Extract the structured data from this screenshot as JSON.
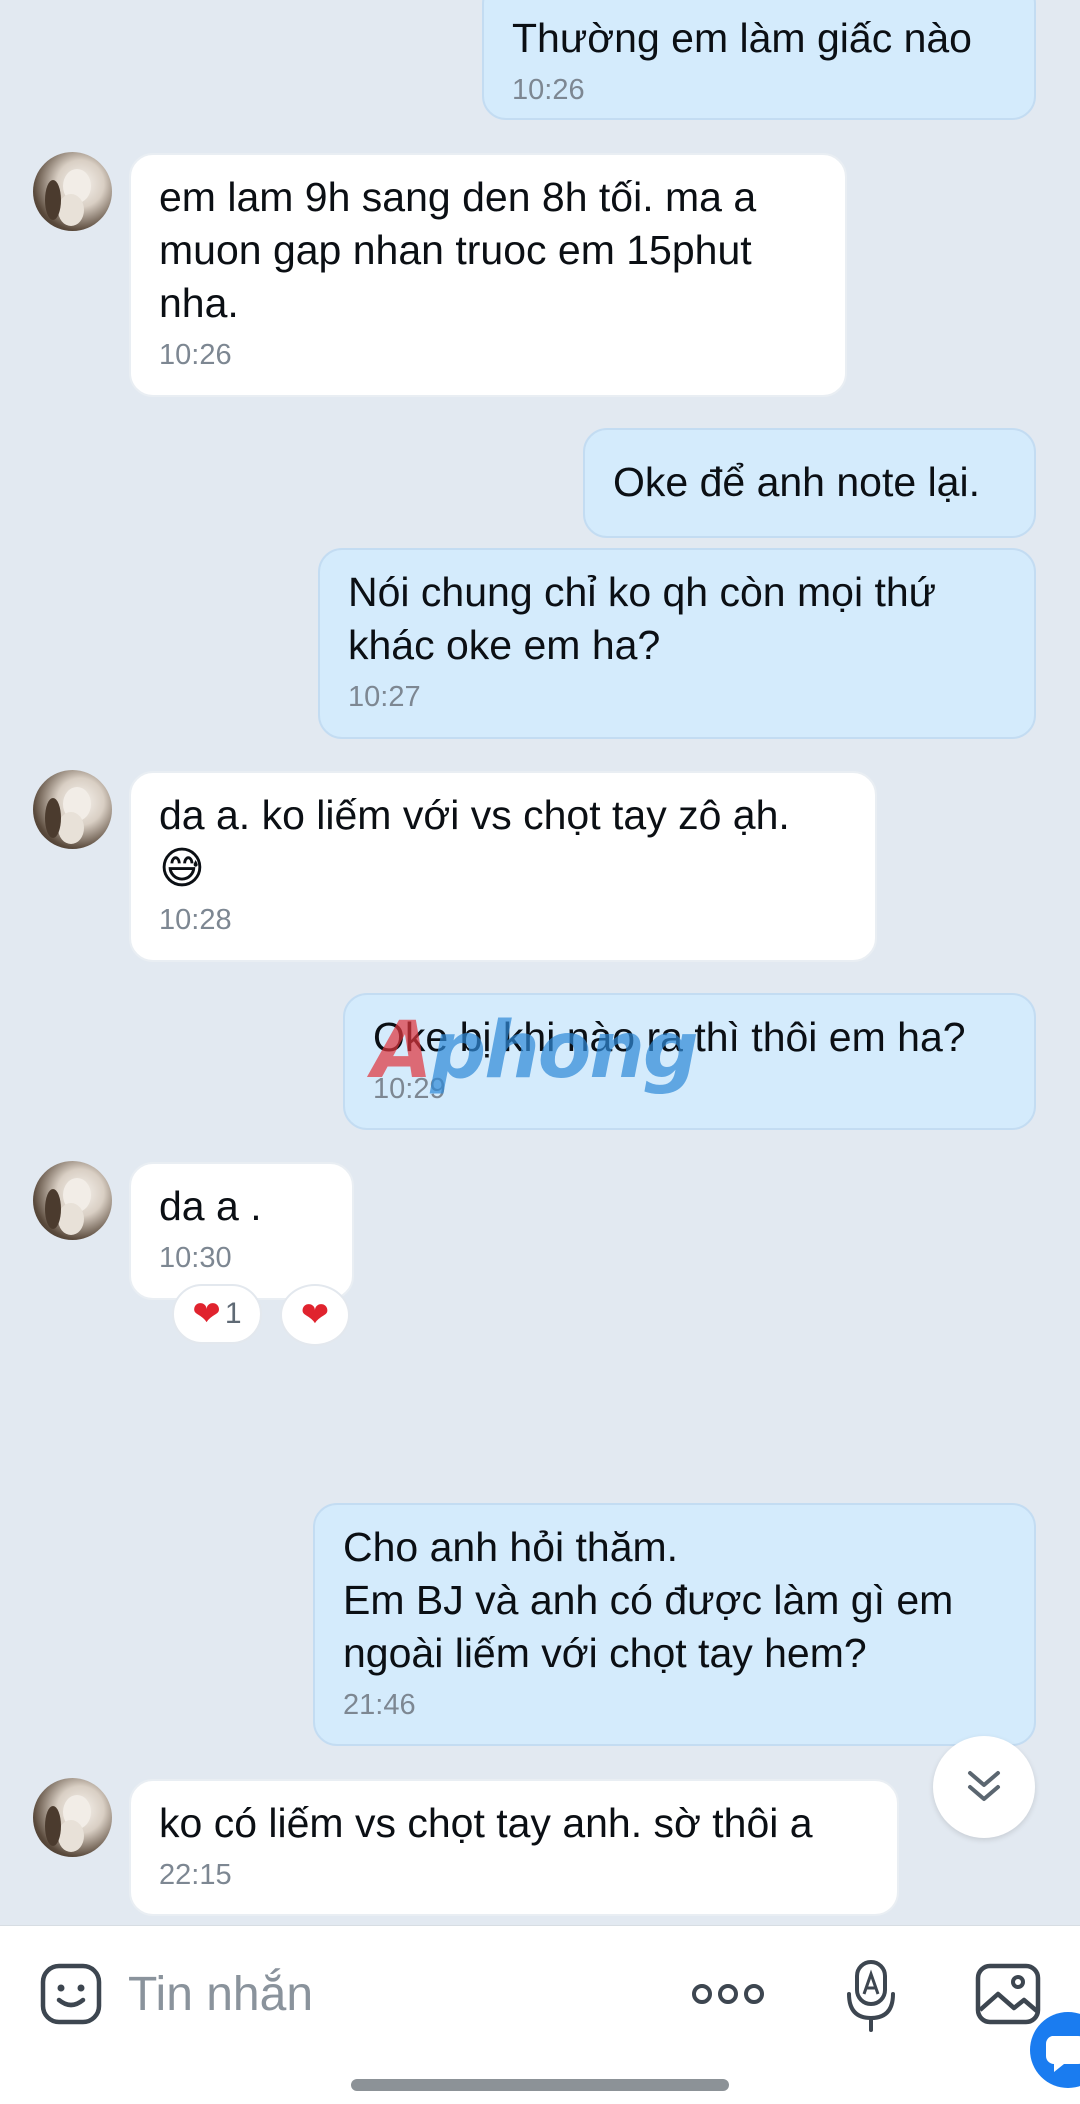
{
  "messages": [
    {
      "text": "Thường em làm giấc nào",
      "time": "10:26"
    },
    {
      "text": "em lam 9h sang den 8h tối. ma a muon gap nhan truoc em 15phut nha.",
      "time": "10:26"
    },
    {
      "text": "Oke để anh note lại.",
      "time": ""
    },
    {
      "text": "Nói chung chỉ ko qh còn mọi thứ khác oke em ha?",
      "time": "10:27"
    },
    {
      "text": "da a. ko liếm với vs chọt tay zô ạh.",
      "time": "10:28",
      "emoji": "😅"
    },
    {
      "text": "Oke bị khi nào ra thì thôi em ha?",
      "time": "10:29"
    },
    {
      "text": "da a .",
      "time": "10:30"
    },
    {
      "text": "Cho anh hỏi thăm.\nEm BJ và anh có được làm gì em ngoài liếm với chọt tay hem?",
      "time": "21:46"
    },
    {
      "text": "ko có liếm vs chọt tay anh. sờ thôi a",
      "time": "22:15"
    }
  ],
  "reactions": {
    "heart_count": "1",
    "heart_glyph": "❤",
    "my_heart_glyph": "❤"
  },
  "watermark": {
    "part1": "A",
    "part2": "phong"
  },
  "composer": {
    "placeholder": "Tin nhắn",
    "value": ""
  },
  "icons": {
    "sticker": "sticker-icon",
    "more": "more-options-icon",
    "voice": "voice-to-text-icon",
    "image": "image-icon",
    "scroll_down": "chevron-double-down-icon"
  },
  "colors": {
    "outgoing_bubble": "#d4ebfc",
    "incoming_bubble": "#ffffff",
    "background": "#e2e9f1",
    "accent": "#1a7cf0"
  }
}
